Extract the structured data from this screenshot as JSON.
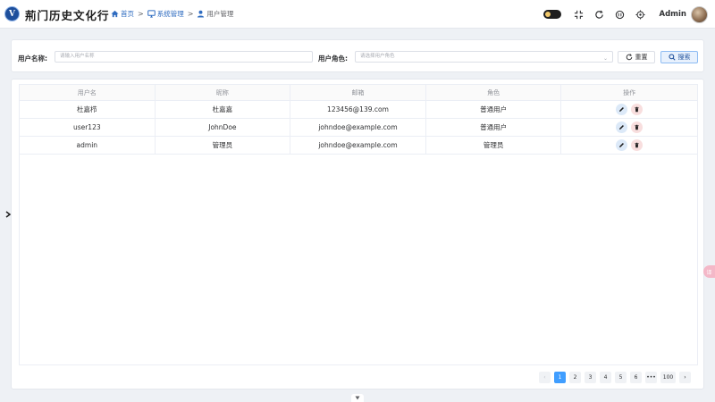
{
  "header": {
    "logo_text": "V",
    "app_title": "荊门历史文化行",
    "breadcrumb": [
      {
        "label": "首页",
        "icon": "home-icon"
      },
      {
        "label": "系统管理",
        "icon": "monitor-icon"
      },
      {
        "label": "用户管理",
        "icon": "user-icon"
      }
    ],
    "separator": ">",
    "user_name": "Admin",
    "icons": [
      "theme-toggle",
      "fullscreen-icon",
      "refresh-icon",
      "sync-icon",
      "locate-icon"
    ]
  },
  "search": {
    "username_label": "用户名称:",
    "username_placeholder": "请输入用户名称",
    "role_label": "用户角色:",
    "role_placeholder": "请选择用户角色",
    "reset_label": "重置",
    "search_label": "搜索"
  },
  "table": {
    "columns": [
      "用户名",
      "昵称",
      "邮箱",
      "角色",
      "操作"
    ],
    "rows": [
      {
        "username": "杜嘉栉",
        "nickname": "杜嘉嘉",
        "email": "123456@139.com",
        "role": "普通用户"
      },
      {
        "username": "user123",
        "nickname": "JohnDoe",
        "email": "johndoe@example.com",
        "role": "普通用户"
      },
      {
        "username": "admin",
        "nickname": "管理员",
        "email": "johndoe@example.com",
        "role": "管理员"
      }
    ]
  },
  "pagination": {
    "prev": "‹",
    "pages": [
      "1",
      "2",
      "3",
      "4",
      "5",
      "6"
    ],
    "ellipsis": "•••",
    "last": "100",
    "next": "›",
    "current": "1"
  },
  "float_tab_label": "译",
  "colors": {
    "primary": "#409eff",
    "brand": "#1e4f9c",
    "link": "#2f6cc0"
  }
}
